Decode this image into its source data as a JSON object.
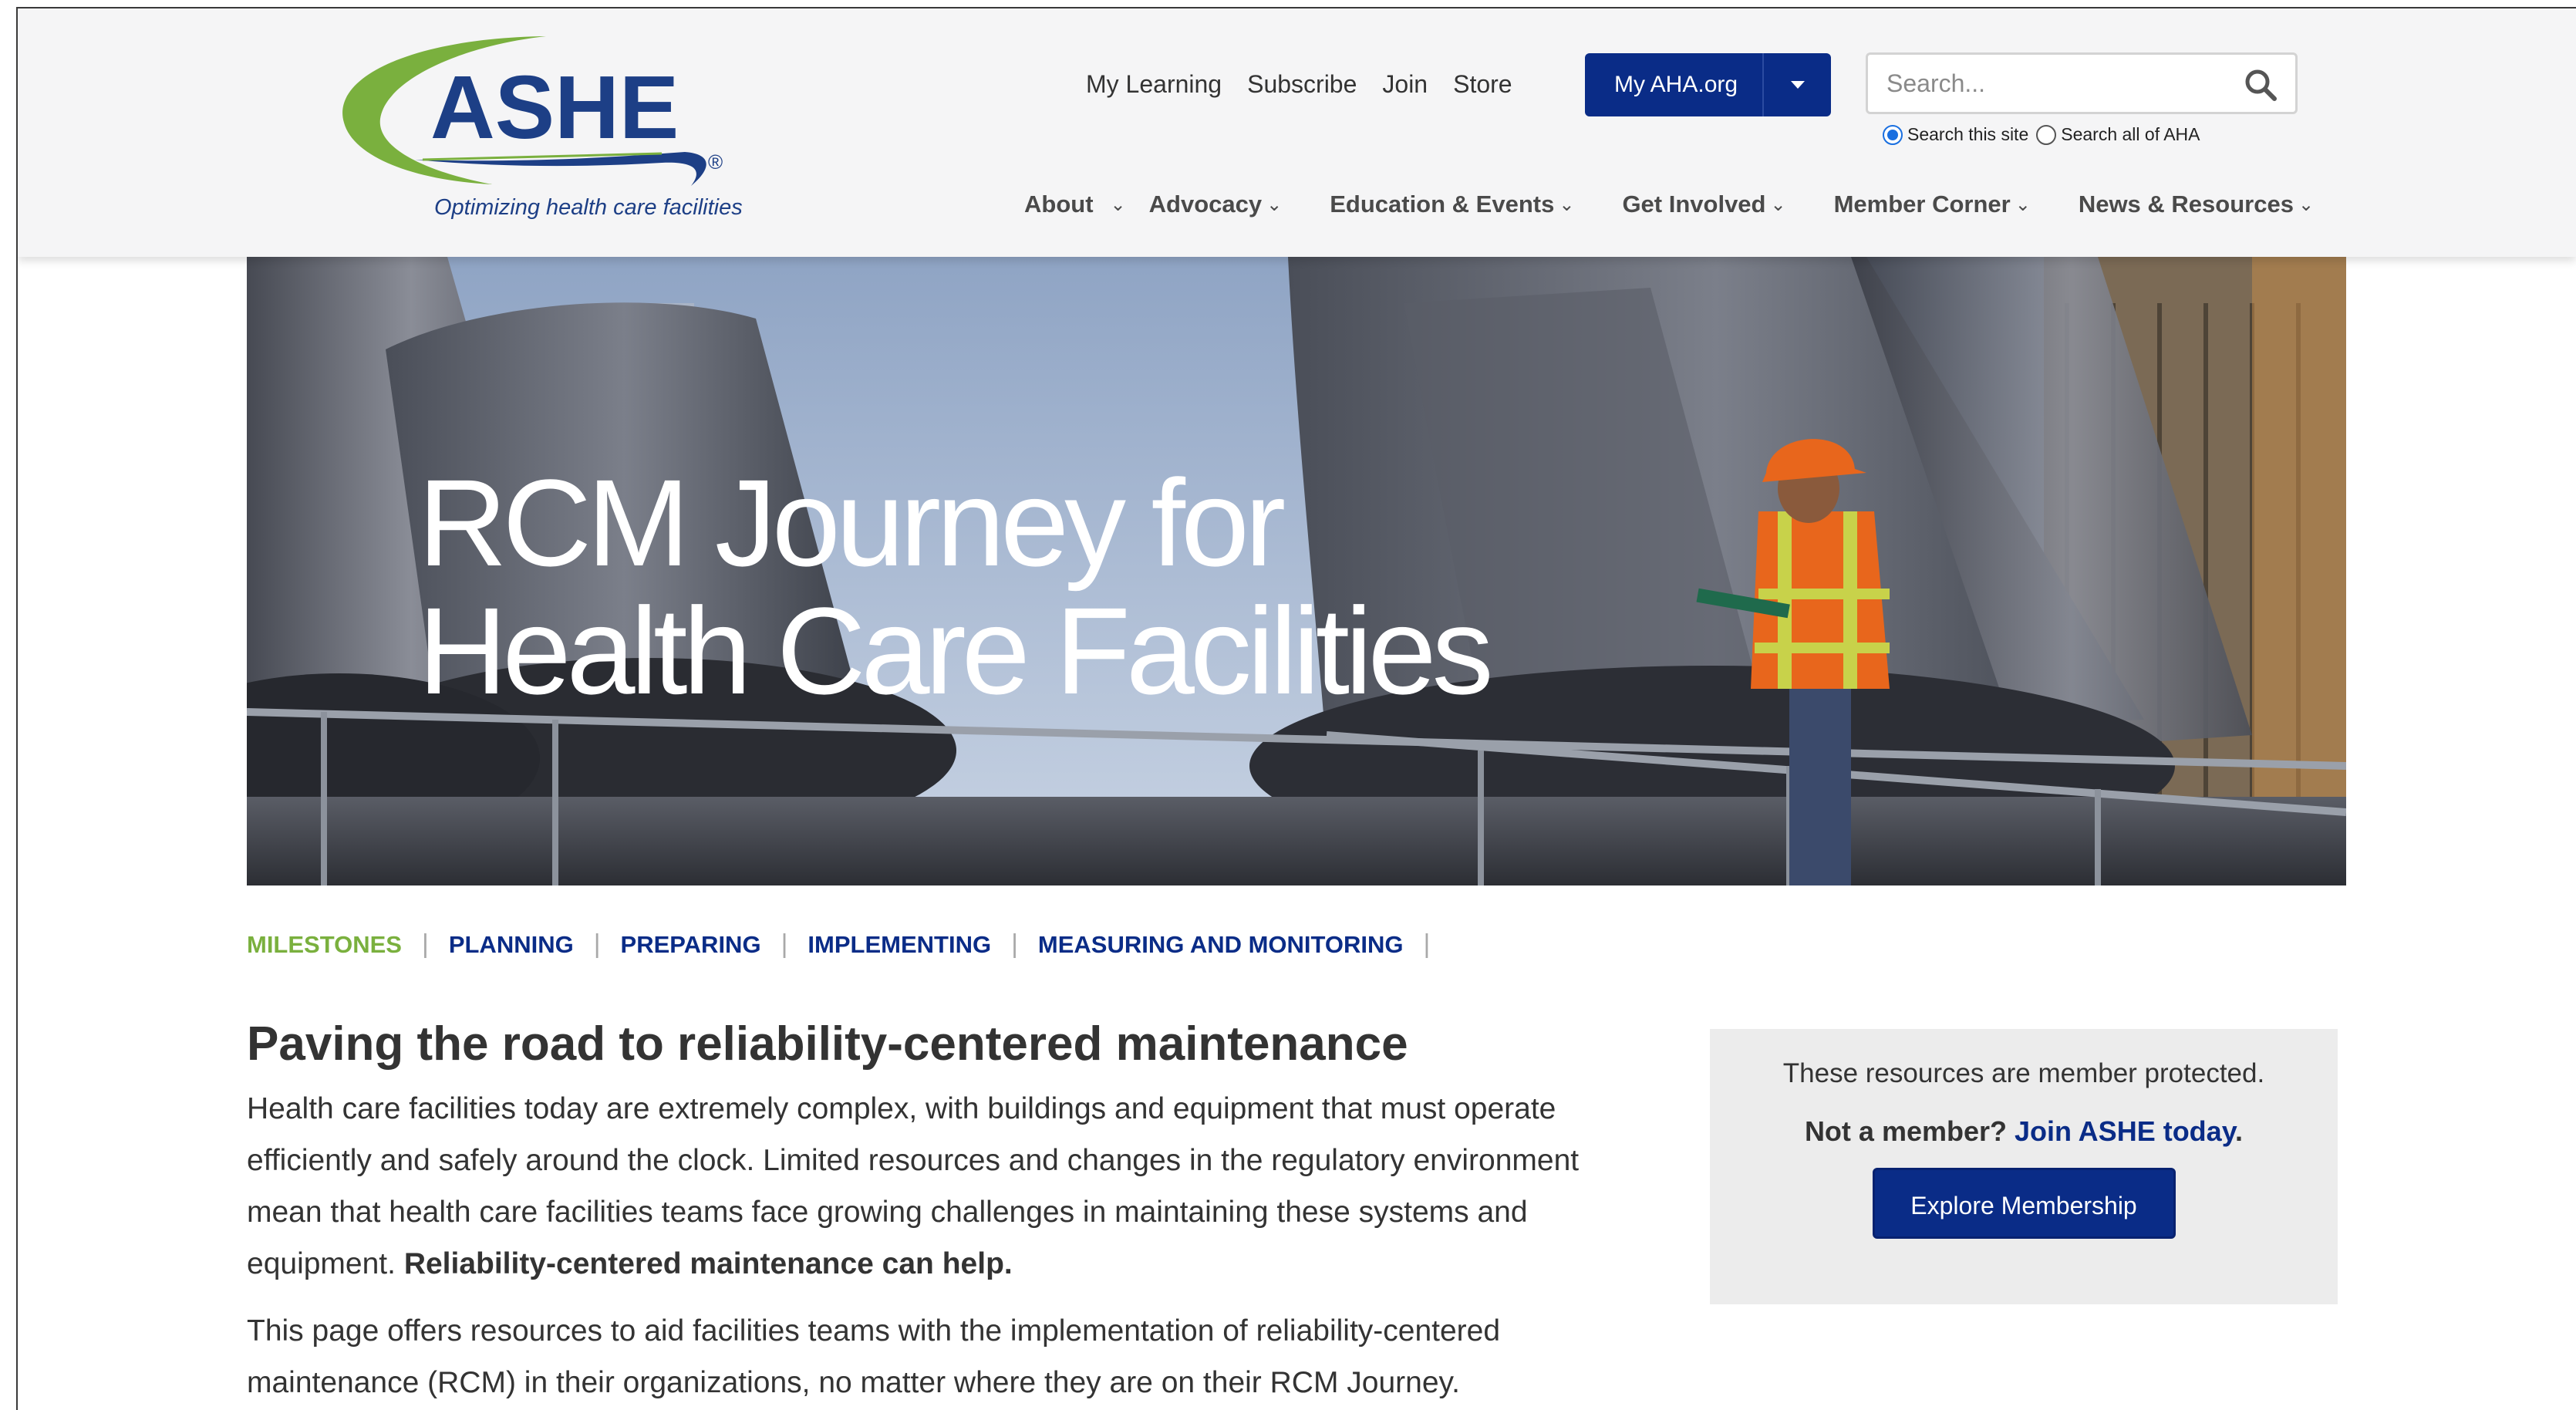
{
  "logo": {
    "wordmark": "ASHE",
    "registered": "®",
    "tagline": "Optimizing health care facilities"
  },
  "utility_nav": [
    "My Learning",
    "Subscribe",
    "Join",
    "Store"
  ],
  "my_aha_button": "My AHA.org",
  "search": {
    "placeholder": "Search...",
    "options": [
      {
        "label": "Search this site",
        "checked": true
      },
      {
        "label": "Search all of AHA",
        "checked": false
      }
    ]
  },
  "main_nav": [
    "About",
    "Advocacy",
    "Education & Events",
    "Get Involved",
    "Member Corner",
    "News & Resources"
  ],
  "hero": {
    "title_line1": "RCM Journey for",
    "title_line2": "Health Care Facilities"
  },
  "sub_nav": [
    {
      "label": "MILESTONES",
      "active": true
    },
    {
      "label": "PLANNING",
      "active": false
    },
    {
      "label": "PREPARING",
      "active": false
    },
    {
      "label": "IMPLEMENTING",
      "active": false
    },
    {
      "label": "MEASURING AND MONITORING",
      "active": false
    }
  ],
  "sub_nav_separator": "|",
  "article": {
    "heading": "Paving the road to reliability-centered maintenance",
    "para1_text": "Health care facilities today are extremely complex, with buildings and equipment that must operate efficiently and safely around the clock. Limited resources and changes in the regulatory environment mean that health care facilities teams face growing challenges in maintaining these systems and equipment.",
    "para1_bold": "Reliability-centered maintenance can help.",
    "para2_text": "This page offers resources to aid facilities teams with the implementation of reliability-centered maintenance (RCM) in their organizations, no matter where they are on their RCM Journey."
  },
  "member_box": {
    "line1": "These resources are member protected.",
    "line2_prefix": "Not a member?",
    "line2_link": "Join ASHE today",
    "line2_suffix": ".",
    "button": "Explore Membership"
  },
  "colors": {
    "brand_navy": "#0a2c87",
    "brand_green": "#7ab03e",
    "header_bg": "#f5f5f6"
  }
}
